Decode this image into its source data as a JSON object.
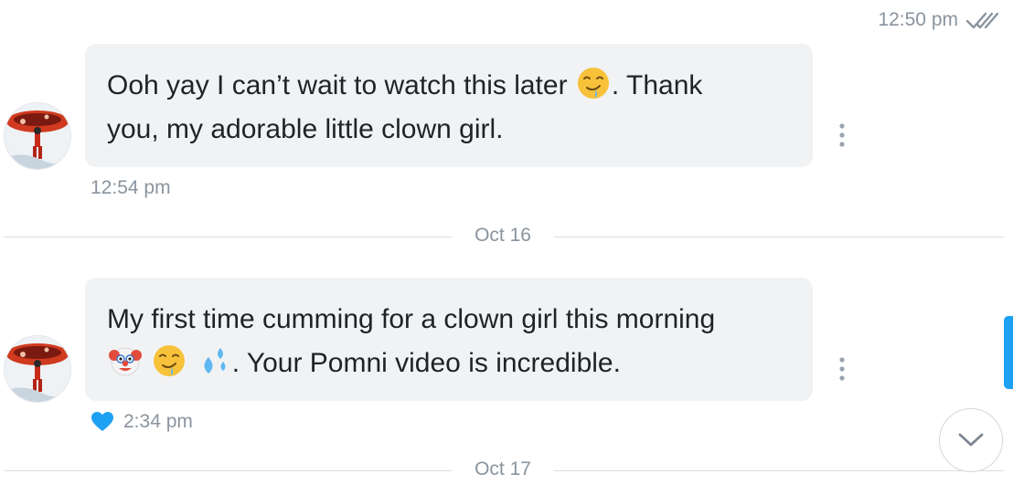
{
  "top_message": {
    "time": "12:50 pm",
    "status_icon": "double-check-icon"
  },
  "messages": [
    {
      "text_line1_a": "Ooh yay I can’t wait to watch this later ",
      "text_line1_b": ". Thank",
      "text_line2": "you, my adorable little clown girl.",
      "emojis": [
        "drooling-face-emoji"
      ],
      "time": "12:54 pm",
      "liked": false
    },
    {
      "text_line1": "My first time cumming for a clown girl this morning",
      "text_line2_b": ". Your Pomni video is incredible.",
      "emojis": [
        "clown-face-emoji",
        "drooling-face-emoji",
        "sweat-droplets-emoji"
      ],
      "time": "2:34 pm",
      "liked": true
    }
  ],
  "date_separators": [
    "Oct 16",
    "Oct 17"
  ],
  "colors": {
    "accent": "#1da1f2",
    "bubble": "#f1f2f4",
    "meta_text": "#8a949e",
    "text": "#1f2328"
  }
}
